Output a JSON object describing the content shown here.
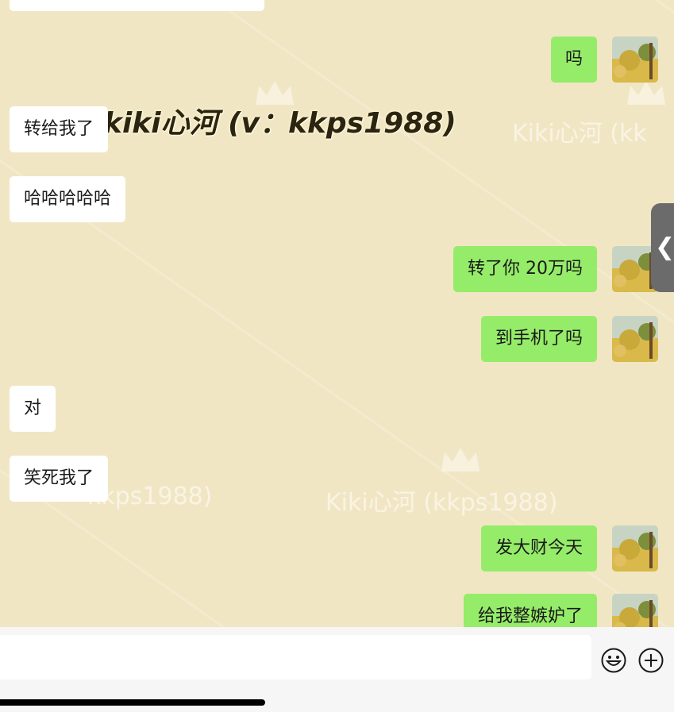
{
  "watermarks": {
    "primary": "kiki心河 (v：kkps1988)",
    "faint_right": "Kiki心河 (kk",
    "faint_center": "Kiki心河 (kkps1988)",
    "faint_left": "kkps1988)"
  },
  "messages": [
    {
      "side": "out",
      "text": "吗"
    },
    {
      "side": "in",
      "text": "转给我了"
    },
    {
      "side": "in",
      "text": "哈哈哈哈哈"
    },
    {
      "side": "out",
      "text": "转了你 20万吗"
    },
    {
      "side": "out",
      "text": "到手机了吗"
    },
    {
      "side": "in",
      "text": "对"
    },
    {
      "side": "in",
      "text": "笑死我了"
    },
    {
      "side": "out",
      "text": "发大财今天"
    },
    {
      "side": "out",
      "text": "给我整嫉妒了"
    }
  ],
  "side_tab": {
    "glyph": "❮"
  },
  "input_bar": {
    "emoji_icon": "smiley-icon",
    "plus_icon": "plus-circle-icon"
  },
  "colors": {
    "background": "#f1e6c4",
    "outgoing_bubble": "#95ec69",
    "incoming_bubble": "#ffffff"
  }
}
